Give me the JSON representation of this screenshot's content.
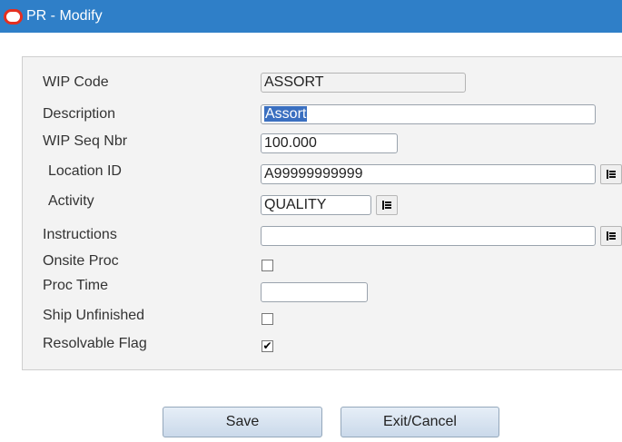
{
  "window": {
    "title": "PR - Modify"
  },
  "form": {
    "wip_code": {
      "label": "WIP Code",
      "value": "ASSORT"
    },
    "description": {
      "label": "Description",
      "value": "Assort"
    },
    "wip_seq_nbr": {
      "label": "WIP Seq Nbr",
      "value": "100.000"
    },
    "location_id": {
      "label": "Location ID",
      "value": "A99999999999"
    },
    "activity": {
      "label": "Activity",
      "value": "QUALITY"
    },
    "instructions": {
      "label": "Instructions",
      "value": ""
    },
    "onsite_proc": {
      "label": "Onsite Proc",
      "checked": false,
      "mark": ""
    },
    "proc_time": {
      "label": "Proc Time",
      "value": ""
    },
    "ship_unfinished": {
      "label": "Ship Unfinished",
      "checked": false,
      "mark": ""
    },
    "resolvable_flag": {
      "label": "Resolvable Flag",
      "checked": true,
      "mark": "✔"
    }
  },
  "buttons": {
    "save": "Save",
    "exit_cancel": "Exit/Cancel"
  },
  "icons": {
    "title_logo": "oracle-logo-icon",
    "lookup": "list-lookup-icon"
  },
  "colors": {
    "titlebar": "#2f7fc8",
    "logo": "#e52f20",
    "selection": "#3a6fc0"
  }
}
